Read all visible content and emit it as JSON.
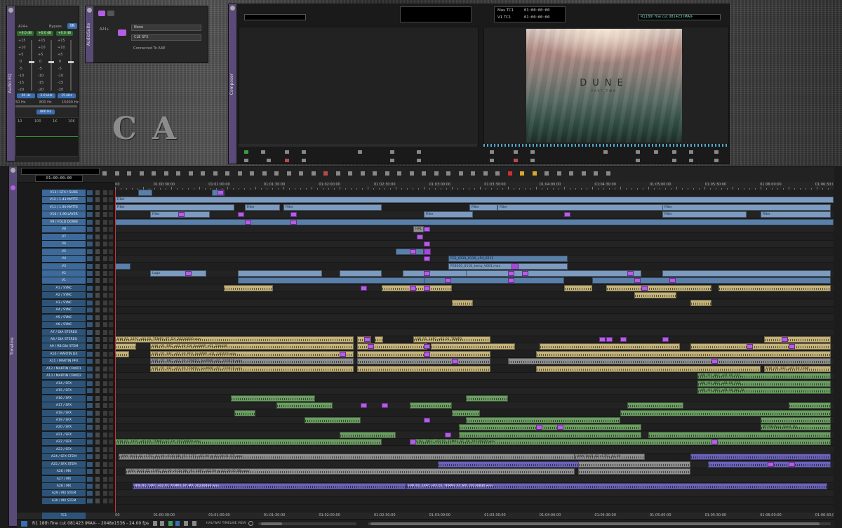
{
  "background": {
    "letters": "CA"
  },
  "audio_eq": {
    "tab_label": "Audio EQ",
    "track": "A24+",
    "bypass_label": "Bypass",
    "bypass_value": "0N",
    "gain_readouts": [
      "+0.0 dB",
      "+0.0 dB",
      "+0.0 dB"
    ],
    "scale": [
      "+15",
      "+10",
      "+5",
      "0",
      "-5",
      "-10",
      "-15",
      "-20"
    ],
    "freq_buttons": [
      "50 Hz",
      "2.0 kHz",
      "15 kHz"
    ],
    "freq_ranges": [
      "50 Hz",
      "800 Hz",
      "15000 Hz"
    ],
    "center_freq": "800 Hz",
    "graph_labels": [
      "10",
      "100",
      "1K",
      "10K"
    ]
  },
  "audio_suite": {
    "tab_label": "AudioSuite",
    "track": "A24+",
    "plugin_dropdown": "None",
    "clip_dropdown": "CLE SFX",
    "status": "Connected To AAE"
  },
  "composer": {
    "tab_label": "Composer",
    "source_dropdown": "",
    "tc_rows": [
      {
        "label": "Mas  TC1",
        "value": "01:00:00:00"
      },
      {
        "label": "V1  TC1",
        "value": "01:00:00:00"
      }
    ],
    "sequence_name": "R118th fine cut 081423 IMAX-",
    "frame_title": "DUNE",
    "frame_subtitle": "PART TWO"
  },
  "timeline": {
    "tab_label": "Timeline",
    "master_tc": "01:00:00:00",
    "ruler": [
      "01:00:00:00",
      "01:00:30:00",
      "01:01:00:00",
      "01:01:30:00",
      "01:02:00:00",
      "01:02:30:00",
      "01:03:00:00",
      "01:03:30:00",
      "01:04:00:00",
      "01:04:30:00",
      "01:05:00:00",
      "01:05:30:00",
      "01:06:00:00",
      "01:06:30:00"
    ],
    "video_tracks": [
      "V13 / GFX / SUBS",
      "V12 / 1.43 MATTE",
      "V11 / 1.90 MATTE",
      "V10 / 1.90 LAYER",
      "V9 / FOLD DOWN",
      "V8",
      "V7",
      "V6",
      "V5",
      "V4",
      "V3",
      "V2",
      "V1"
    ],
    "audio_tracks": [
      "A1 / SYNC",
      "A2 / SYNC",
      "A3 / SYNC",
      "A4 / SYNC",
      "A5 / SYNC",
      "A6 / SYNC",
      "A7 / DIA STEREO",
      "A8 / DIA STEREO",
      "A9 / RB DIA STEM",
      "A10 / MARTIN DX",
      "A11 / MARTIN PFX",
      "A12 / MARTIN CRWD1",
      "A13 / MARTIN CRWD2",
      "A14 / SFX",
      "A15 / SFX",
      "A16 / SFX",
      "A17 / SFX",
      "A18 / SFX",
      "A19 / SFX",
      "A20 / SFX",
      "A21 / SFX",
      "A22 / SFX",
      "A23 / SFX",
      "A24 / SFX STEM",
      "A25 / SFX STEM",
      "A26 / MX",
      "A27 / MX",
      "A28 / MX",
      "A29 / MX STEM",
      "A30 / MX STEM"
    ],
    "tc1_label": "TC1",
    "halfway_label": "HALFWAY TIMELINE VIEW",
    "status": "R1 18th fine cut 081423 IMAX- - 2048x1536 - 24.00 fps",
    "clips": {
      "filler": "Filler",
      "hal": "HAL",
      "logo": "Logo",
      "fes1": "FES_0110_0110_v54_0211",
      "fes2": "FES010_0110_temp_V001.mov",
      "dx_a9": "HW_R1_14FC_v02.01_TEMP3_ST_DX_20230830.wav",
      "dx_a9b": "HW_R1_14FC_v02.01_TEMP3",
      "pfx_a10": "HW_r01_BFC_v01.00_DX_SndWIP_v01_230428",
      "pfx_a11": "HW_r01_BFC_v01.00_PFX_SndWIP_v01_230428.wav",
      "crwd1": "HW_r01_BFC_v01.00_CRWD1_SndWIP_v01_230428.wav",
      "crwd2": "HW_r01_BFC_v01.00_CRWD2_SndWIP_v01_230428.wav",
      "crwd2b": "HW_r01_BFC_v01.00_CRW",
      "fx1": "HW_r01_BFC_v01.00_FX1_",
      "fx2": "HW_r01_BFC_v01.00_FX2_",
      "bg": "HW_r01_BFC_v01.00_BG_SI",
      "fx_stem": "HW_R1_14FC_v02.01_TEMP3_ST_FX_20230830.wav",
      "fx_stem2": "HW_R1_14FC_v02.01_TEMP3_ST_FX_20230830.wav",
      "mx1": "HWY 1h01-02 c17FC_01.00 v9.00 SM_(R1 17FC v01.00 @ 01.00.01.07).wav",
      "mx1b": "HWY 1h01-02 c17FC_01.00",
      "mx2": "HWY 1h01-02 c14FC_02.00 v6.00 SM_(R1 18FC v02.00 @ 01.00.05.08).wav",
      "mx3": "HW_R1_14FC_v02.01_TEMP3_ST_MX_20230830.wav",
      "mx3b": "HW_R1_14FC_v02.01_TEMP3_ST_MX_20230830.wav",
      "sfx_pour": "BT208-Pour_Sand_Ou"
    }
  }
}
